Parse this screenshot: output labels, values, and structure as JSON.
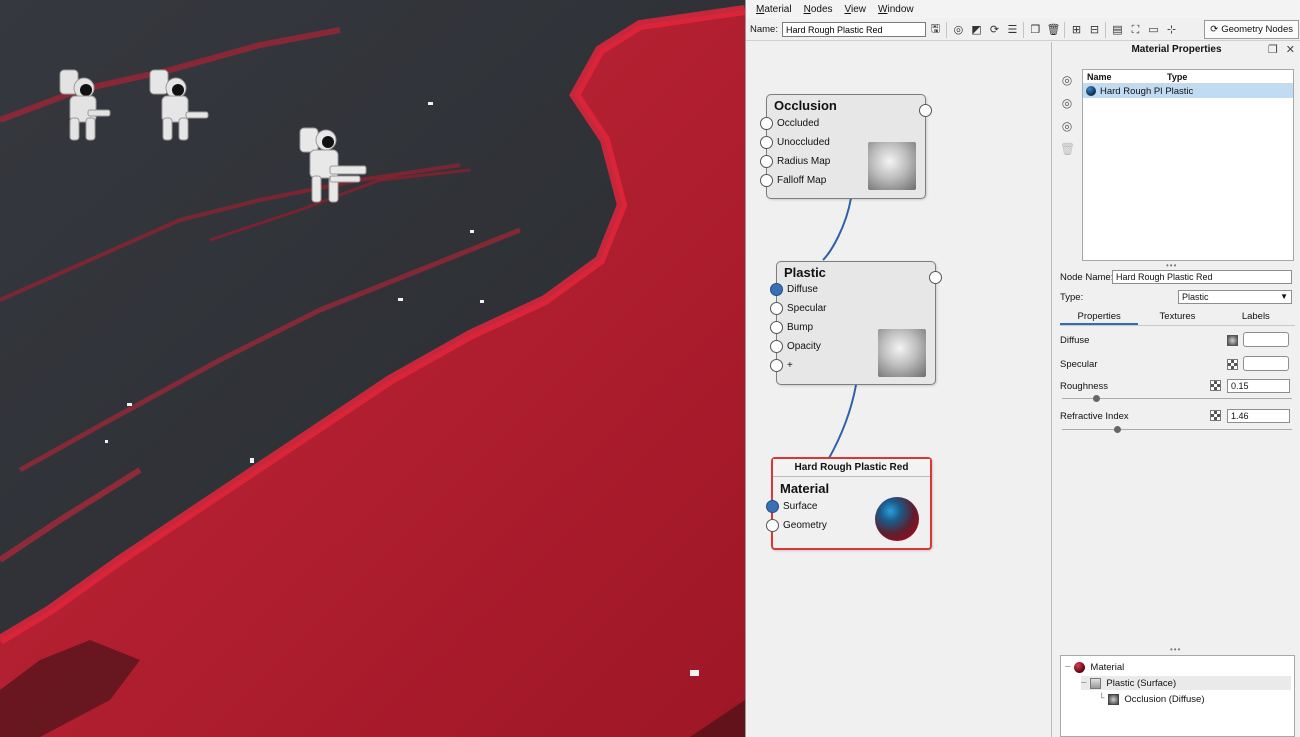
{
  "menubar": {
    "items": [
      "Material",
      "Nodes",
      "View",
      "Window"
    ]
  },
  "toolbar": {
    "name_label": "Name:",
    "name_value": "Hard Rough Plastic Red",
    "geometry_nodes_label": "Geometry Nodes",
    "icons": [
      "save-icon",
      "assign-material-icon",
      "select-icon",
      "refresh-icon",
      "adjust-icon",
      "copy-icon",
      "delete-icon",
      "add-node-icon",
      "remove-node-icon",
      "arrange-icon",
      "fit-view-icon",
      "zoom-100-icon",
      "connect-icon"
    ]
  },
  "graph": {
    "occlusion": {
      "title": "Occlusion",
      "inputs": [
        "Occluded",
        "Unoccluded",
        "Radius Map",
        "Falloff Map"
      ]
    },
    "plastic": {
      "title": "Plastic",
      "inputs": [
        "Diffuse",
        "Specular",
        "Bump",
        "Opacity",
        "+"
      ]
    },
    "material": {
      "header": "Hard Rough Plastic Red",
      "title": "Material",
      "inputs": [
        "Surface",
        "Geometry"
      ]
    },
    "wire_color": "#2b62a8",
    "selected_color": "#d93636"
  },
  "properties": {
    "title": "Material Properties",
    "list": {
      "col_name": "Name",
      "col_type": "Type",
      "row_name": "Hard Rough Pl",
      "row_type": "Plastic"
    },
    "node_name_label": "Node Name:",
    "node_name_value": "Hard Rough Plastic Red",
    "type_label": "Type:",
    "type_value": "Plastic",
    "tabs": [
      "Properties",
      "Textures",
      "Labels"
    ],
    "diffuse_label": "Diffuse",
    "specular_label": "Specular",
    "roughness_label": "Roughness",
    "roughness_value": "0.15",
    "roughness_fraction": 0.15,
    "refractive_label": "Refractive Index",
    "refractive_value": "1.46",
    "refractive_fraction": 0.24
  },
  "tree": {
    "rows": [
      "Material",
      "Plastic (Surface)",
      "Occlusion (Diffuse)"
    ]
  },
  "viewport": {
    "surface_color": "#b01d2d",
    "rock_color": "#2c2e33"
  }
}
